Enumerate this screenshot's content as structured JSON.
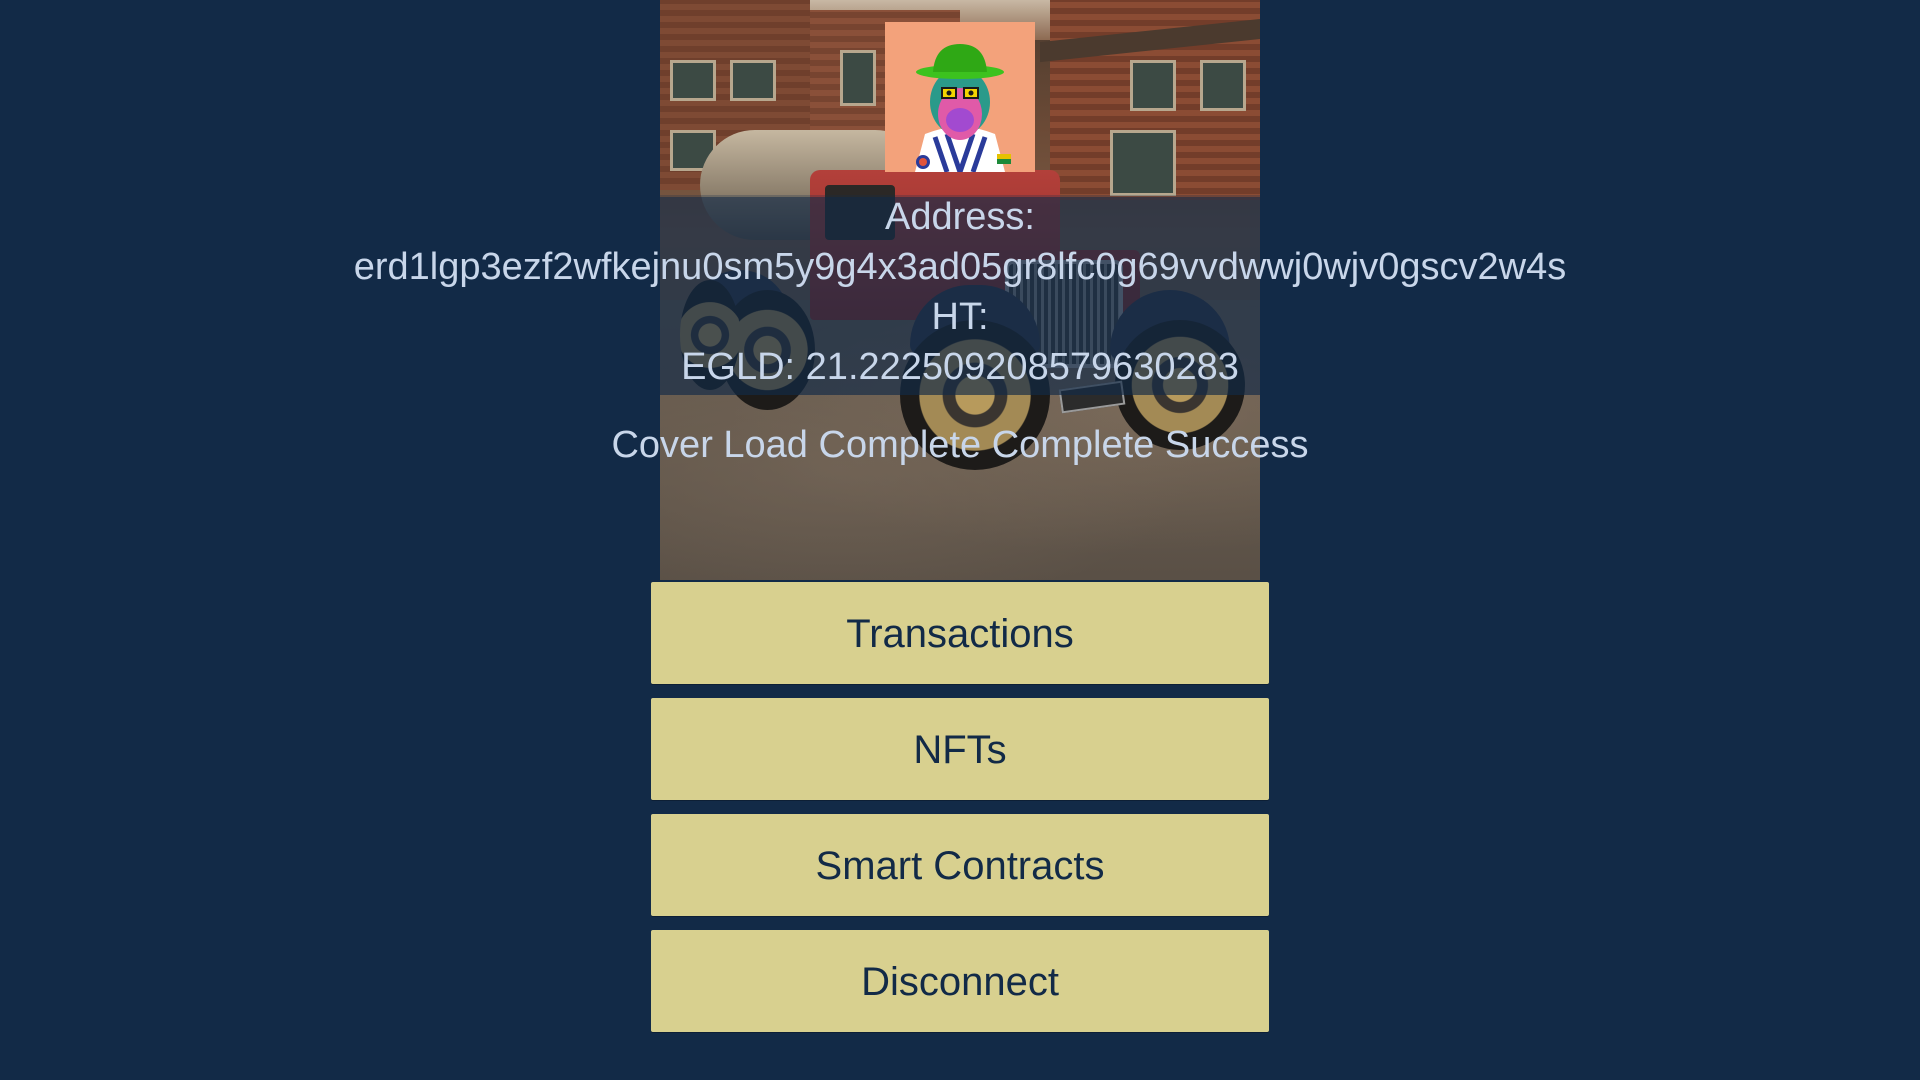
{
  "wallet": {
    "address_label": "Address:",
    "address": "erd1lgp3ezf2wfkejnu0sm5y9g4x3ad05gr8lfc0g69vvdwwj0wjv0gscv2w4s",
    "ht_label": "HT:",
    "egld_balance": "EGLD: 21.2225092085796302​83"
  },
  "status": {
    "text": "Cover Load Complete Complete Success"
  },
  "buttons": {
    "transactions": "Transactions",
    "nfts": "NFTs",
    "smart_contracts": "Smart Contracts",
    "disconnect": "Disconnect"
  },
  "images": {
    "cover": "truck-cover-image",
    "avatar": "nft-avatar-image"
  },
  "colors": {
    "background": "#122a47",
    "button": "#d8d08f",
    "button_text": "#122a47",
    "info_text": "#c8d6ea"
  }
}
